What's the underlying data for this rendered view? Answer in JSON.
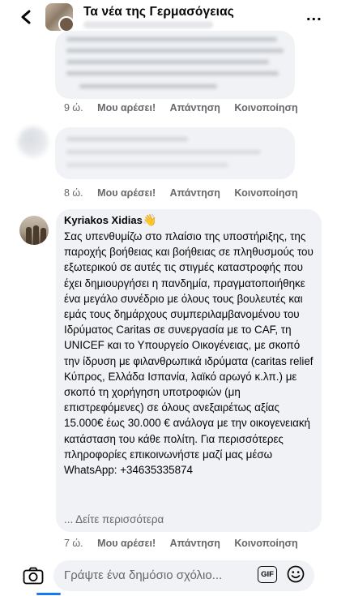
{
  "header": {
    "title": "Τα νέα της Γερμασόγειας",
    "back_icon": "chevron-left-icon",
    "more_icon": "more-dots-icon",
    "more_label": "..."
  },
  "comments": [
    {
      "time": "9 ώ.",
      "like": "Μου αρέσει!",
      "reply": "Απάντηση",
      "share": "Κοινοποίηση"
    },
    {
      "time": "8 ώ.",
      "like": "Μου αρέσει!",
      "reply": "Απάντηση",
      "share": "Κοινοποίηση"
    }
  ],
  "main_comment": {
    "author": "Kyriakos Xidias",
    "badge": "👋",
    "body": "Σας υπενθυμίζω στο πλαίσιο της υποστήριξης, της παροχής βοήθειας και βοήθειας σε πληθυσμούς του εξωτερικού σε αυτές τις στιγμές καταστροφής που έχει δημιουργήσει η πανδημία, πραγματοποιήθηκε ένα μεγάλο συνέδριο με όλους τους βουλευτές και εμάς τους δημάρχους συμπεριλαμβανομένου του Ιδρύματος Caritas σε συνεργασία με το CAF, τη UNICEF και το Υπουργείο Οικογένειας, με σκοπό την ίδρυση με φιλανθρωπικά ιδρύματα (caritas relief Κύπρος, Ελλάδα Ισπανία, λαϊκό αρωγό κ.λπ.) με σκοπό τη χορήγηση υποτροφιών (μη επιστρεφόμενες) σε όλους ανεξαιρέτως αξίας 15.000€ έως 30.000 € ανάλογα με την οικογενειακή κατάσταση του κάθε πολίτη.  Για περισσότερες πληροφορίες επικοινωνήστε μαζί μας μέσω WhatsApp: +34635335874",
    "see_more": "... Δείτε περισσότερα",
    "time": "7 ώ.",
    "like": "Μου αρέσει!",
    "reply": "Απάντηση",
    "share": "Κοινοποίηση"
  },
  "composer": {
    "placeholder": "Γράψτε ένα δημόσιο σχόλιο...",
    "gif_label": "GIF",
    "camera_icon": "camera-icon",
    "emoji_icon": "smiley-icon"
  }
}
